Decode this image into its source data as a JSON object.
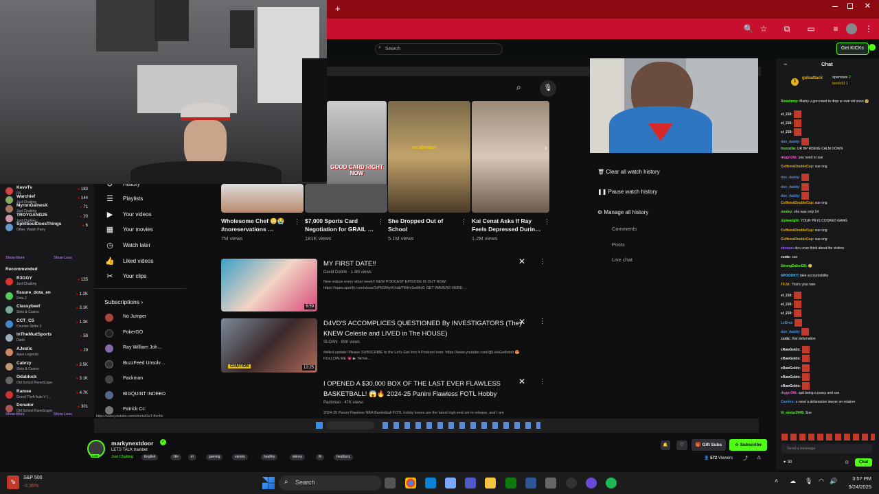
{
  "browser": {
    "new_tab": "+"
  },
  "kick": {
    "search_placeholder": "Search",
    "get_kicks": "Get KICKs",
    "chat_title": "Chat"
  },
  "sidebar": {
    "channels": [
      {
        "name": "KevvTv",
        "cat": "IRL",
        "count": "183",
        "color": "#c44"
      },
      {
        "name": "Warchief",
        "cat": "Just Chatting",
        "count": "144",
        "color": "#8a6"
      },
      {
        "name": "MyronGainesX",
        "cat": "Just Chatting",
        "count": "71",
        "color": "#a76"
      },
      {
        "name": "TROYGANG25",
        "cat": "Just Chatting",
        "count": "20",
        "color": "#c9a"
      },
      {
        "name": "SplitSoulDoesThings",
        "cat": "Other, Watch Party",
        "count": "6",
        "color": "#69c"
      }
    ],
    "show_more": "Show More",
    "show_less": "Show Less",
    "recommended_title": "Recommended",
    "recommended": [
      {
        "name": "R3GGY",
        "cat": "Just Chatting",
        "count": "135",
        "color": "#d33"
      },
      {
        "name": "fissure_dota_en",
        "cat": "Dota 2",
        "count": "1.2K",
        "color": "#5c5"
      },
      {
        "name": "Classybeef",
        "cat": "Slots & Casino",
        "count": "3.1K",
        "color": "#7a9"
      },
      {
        "name": "CCT_CS",
        "cat": "Counter-Strike 2",
        "count": "1.3K",
        "color": "#48c"
      },
      {
        "name": "InTheMudSports",
        "cat": "Darts",
        "count": "59",
        "color": "#9ab"
      },
      {
        "name": "AJestic",
        "cat": "Apex Legends",
        "count": "29",
        "color": "#c86"
      },
      {
        "name": "Cabrzy",
        "cat": "Slots & Casino",
        "count": "2.5K",
        "color": "#b97"
      },
      {
        "name": "Odablock",
        "cat": "Old School RuneScape",
        "count": "3.1K",
        "color": "#666"
      },
      {
        "name": "Ramee",
        "cat": "Grand Theft Auto V (…",
        "count": "4.7K",
        "color": "#c33"
      },
      {
        "name": "Donator",
        "cat": "Old School RuneScape",
        "count": "301",
        "color": "#a55"
      }
    ]
  },
  "youtube": {
    "nav": [
      {
        "label": "History",
        "icon": "history-icon"
      },
      {
        "label": "Playlists",
        "icon": "playlist-icon"
      },
      {
        "label": "Your videos",
        "icon": "video-icon"
      },
      {
        "label": "Your movies",
        "icon": "movie-icon"
      },
      {
        "label": "Watch later",
        "icon": "clock-icon"
      },
      {
        "label": "Liked videos",
        "icon": "thumbs-up-icon"
      },
      {
        "label": "Your clips",
        "icon": "scissors-icon"
      }
    ],
    "subs_title": "Subscriptions",
    "subs": [
      {
        "name": "No Jumper",
        "color": "#a44"
      },
      {
        "name": "PokerGO",
        "color": "#222"
      },
      {
        "name": "Ray William Joh…",
        "color": "#86a"
      },
      {
        "name": "BuzzFeed Unsolv…",
        "color": "#333"
      },
      {
        "name": "Packman",
        "color": "#444"
      },
      {
        "name": "BIGQUINT INDEED",
        "color": "#568"
      },
      {
        "name": "Patrick Cc:",
        "color": "#777"
      }
    ],
    "shorts": [
      {
        "title": "Wholesome Chef 😳😭 #noreservations …",
        "views": "7M views"
      },
      {
        "title": "$7,000 Sports Card Negotiation for GRAIL …",
        "views": "181K views"
      },
      {
        "title": "She Dropped Out of School",
        "views": "5.1M views"
      },
      {
        "title": "Kai Cenat Asks If Ray Feels Depressed Durin…",
        "views": "1.2M views"
      }
    ],
    "short_caption_1": "GOOD CARD RIGHT NOW",
    "short_caption_2": "no abortion",
    "videos": [
      {
        "title": "MY FIRST DATE!!",
        "meta": "David Dobrik  ·  1.3M views",
        "desc": "New videos every other week!! NEW PODCAST EPISODE IS OUT NOW: https://open.spotify.com/show/1vPkGMyrKXdbYWHxSw9kd1 GET WAVERS HERE:…",
        "duration": "6:59"
      },
      {
        "title": "D4VD'S ACCOMPLICES QUESTIONED By INVESTIGATORS (They KNEW Celeste and LIVED in The HOUSE)",
        "meta": "SLOAN  ·  89K views",
        "desc": "#d4vd update! Please SUBSCRIBE to the Let's Get Into It Podcast here: https://www.youtube.com/@LetsGetIntoIt 😍 FOLLOW ME 💗 ▶ TikTok…",
        "duration": "12:25",
        "badge": "CAUTION"
      },
      {
        "title": "I OPENED A $30,000 BOX OF THE LAST EVER FLAWLESS BASKETBALL! 😱🔥 2024-25 Panini Flawless FOTL Hobby",
        "meta": "Packman  ·  47K views",
        "desc": "2024-25 Panini Flawless NBA Basketball FOTL hobby boxes are the latest high-end set to release, and I am"
      }
    ],
    "history_actions": [
      "Clear all watch history",
      "Pause watch history",
      "Manage all history"
    ],
    "history_sub": [
      "Comments",
      "Posts",
      "Live chat"
    ],
    "status_url": "https://www.youtube.com/shorts/t3aT-Bcr4lo"
  },
  "chat": {
    "top": {
      "user1": "gatoattack",
      "user2": "sparrows",
      "user2_count": "2",
      "user3": "berlo93",
      "user3_count": "1",
      "rank": "1"
    },
    "lines": [
      {
        "user": "Rewstrmp:",
        "color": "#53fc18",
        "text": " Marky u gon need to drop ur own vid soon 😭"
      },
      {
        "user": "el_210:",
        "color": "#efeff1",
        "text": "",
        "emote": true
      },
      {
        "user": "el_210:",
        "color": "#efeff1",
        "text": "",
        "emote": true
      },
      {
        "user": "el_210:",
        "color": "#efeff1",
        "text": "",
        "emote": true
      },
      {
        "user": "don_daddy:",
        "color": "#4a90e2",
        "text": "",
        "emote": true
      },
      {
        "user": "Huntzilla:",
        "color": "#53fc18",
        "text": " UR BP RISING CALM DOWN"
      },
      {
        "user": "rbygrr34z:",
        "color": "#ff5cdb",
        "text": " you need to sue"
      },
      {
        "user": "CuffemsDoubleCup:",
        "color": "#e4b01c",
        "text": " sue ong"
      },
      {
        "user": "don_daddy:",
        "color": "#4a90e2",
        "text": "",
        "emote": true
      },
      {
        "user": "don_daddy:",
        "color": "#4a90e2",
        "text": "",
        "emote": true
      },
      {
        "user": "don_daddy:",
        "color": "#4a90e2",
        "text": "",
        "emote": true
      },
      {
        "user": "CuffemsDoubleCup:",
        "color": "#e4b01c",
        "text": " sue ong"
      },
      {
        "user": "oonley:",
        "color": "#53fc18",
        "text": " she was only 14"
      },
      {
        "user": "nickweight:",
        "color": "#53fc18",
        "text": " YOUR PR IS COOKED GANG"
      },
      {
        "user": "CuffemsDoubleCup:",
        "color": "#e4b01c",
        "text": " sue ong"
      },
      {
        "user": "CuffemsDoubleCup:",
        "color": "#e4b01c",
        "text": " sue ong"
      },
      {
        "user": "virzsus:",
        "color": "#a970ff",
        "text": " do u ever think about the victims"
      },
      {
        "user": "cuntz:",
        "color": "#efeff1",
        "text": " sue"
      },
      {
        "user": "StrongDabs420:",
        "color": "#53fc18",
        "text": " 🙂"
      },
      {
        "user": "SPOOOKY:",
        "color": "#4ac6ff",
        "text": " take accountability"
      },
      {
        "user": "TFJA:",
        "color": "#e4b01c",
        "text": " That's your twin"
      },
      {
        "user": "el_210:",
        "color": "#efeff1",
        "text": "",
        "emote": true
      },
      {
        "user": "el_210:",
        "color": "#efeff1",
        "text": "",
        "emote": true
      },
      {
        "user": "el_210:",
        "color": "#efeff1",
        "text": "",
        "emote": true
      },
      {
        "user": "LeDrez:",
        "color": "#4a90e2",
        "text": "",
        "emote": true
      },
      {
        "user": "don_daddy:",
        "color": "#4a90e2",
        "text": "",
        "emote": true
      },
      {
        "user": "cuntz:",
        "color": "#efeff1",
        "text": " that defamation"
      },
      {
        "user": "xRawGoldx:",
        "color": "#efeff1",
        "text": "",
        "emote": true
      },
      {
        "user": "xRawGoldx:",
        "color": "#efeff1",
        "text": "",
        "emote": true
      },
      {
        "user": "xRawGoldx:",
        "color": "#efeff1",
        "text": "",
        "emote": true
      },
      {
        "user": "xRawGoldx:",
        "color": "#efeff1",
        "text": "",
        "emote": true
      },
      {
        "user": "xRawGoldx:",
        "color": "#efeff1",
        "text": "",
        "emote": true
      },
      {
        "user": "rbygrr34z:",
        "color": "#ff5cdb",
        "text": " quit being a pussy and sue"
      },
      {
        "user": "Camiiro:",
        "color": "#4a90e2",
        "text": " u need a defamation lawyer on retainer"
      },
      {
        "user": "lil_winter2949:",
        "color": "#53fc18",
        "text": " Sue"
      }
    ],
    "input_placeholder": "Send a message",
    "points": "30",
    "chat_button": "Chat"
  },
  "stream": {
    "name": "markynextdoor",
    "title": "LETS TALK trainbet",
    "category": "Just Chatting",
    "tags": [
      "English",
      "18+",
      "irl",
      "gaming",
      "variety",
      "healthy",
      "skinny",
      "fit",
      "heathsnc"
    ],
    "gift": "Gift Subs",
    "subscribe": "Subscribe",
    "viewers": "572",
    "viewers_label": "Viewers"
  },
  "taskbar": {
    "stock_name": "S&P 500",
    "stock_change": "-0.36%",
    "search": "Search",
    "time": "3:57 PM",
    "date": "9/24/2025"
  },
  "colors": {
    "kick_green": "#53fc18",
    "browser_red": "#c8102e",
    "live_red": "#eb0400"
  }
}
